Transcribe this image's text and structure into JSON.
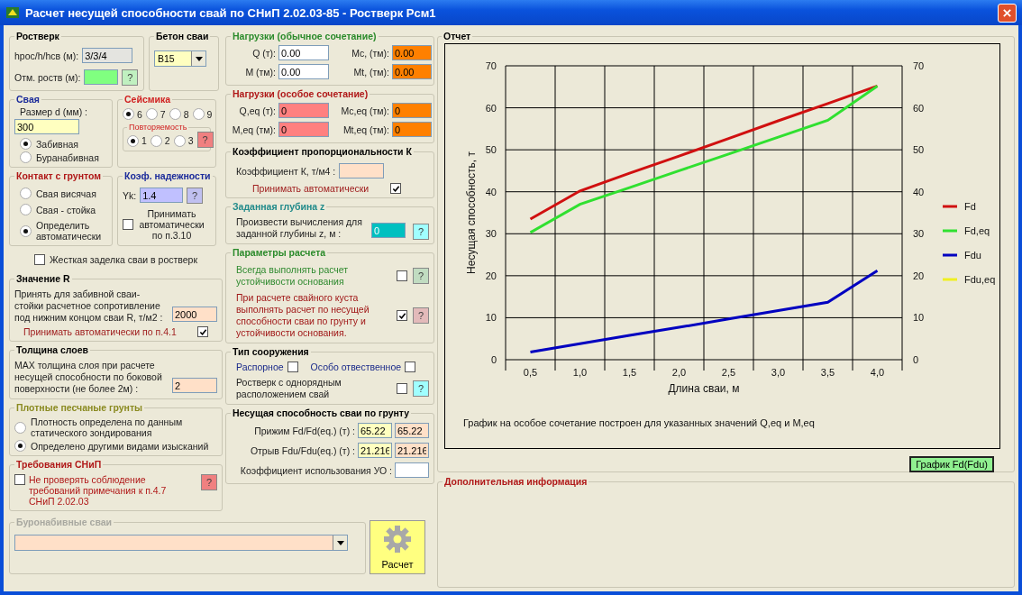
{
  "window": {
    "title": "Расчет несущей способности свай по СНиП 2.02.03-85 - Ростверк Рсм1"
  },
  "rostverk": {
    "title": "Ростверк",
    "height_label": "hрос/h/hсв (м):",
    "height_value": "3/3/4",
    "mark_label": "Отм. роств (м):",
    "mark_help": "?"
  },
  "concrete": {
    "title": "Бетон сваи",
    "value": "B15"
  },
  "pile": {
    "title": "Свая",
    "size_label": "Размер d (мм) :",
    "size_value": "300",
    "types": [
      {
        "label": "Забивная",
        "selected": true
      },
      {
        "label": "Буранабивная",
        "selected": false
      }
    ]
  },
  "seismic": {
    "title": "Сейсмика",
    "options": [
      {
        "label": "6",
        "selected": true
      },
      {
        "label": "7",
        "selected": false
      },
      {
        "label": "8",
        "selected": false
      },
      {
        "label": "9",
        "selected": false
      }
    ],
    "repeat": {
      "title": "Повторяемость",
      "options": [
        {
          "label": "1",
          "selected": true
        },
        {
          "label": "2",
          "selected": false
        },
        {
          "label": "3",
          "selected": false
        }
      ],
      "help": "?"
    }
  },
  "contact": {
    "title": "Контакт с грунтом",
    "options": [
      {
        "label": "Свая висячая",
        "selected": false
      },
      {
        "label": "Свая - стойка",
        "selected": false
      },
      {
        "label": "Определить автоматически",
        "selected": true
      }
    ]
  },
  "reliability": {
    "title": "Коэф. надежности",
    "label": "Yk:",
    "value": "1.4",
    "help": "?",
    "auto": {
      "label": "Принимать автоматически по п.3.10",
      "checked": false
    }
  },
  "rigid": {
    "label": "Жесткая заделка сваи в ростверк",
    "checked": false
  },
  "r_value": {
    "title": "Значение R",
    "text": "Принять для забивной сваи-стойки расчетное сопротивление под нижним концом сваи R, т/м2 :",
    "value": "2000",
    "auto": {
      "label": "Принимать автоматически по п.4.1",
      "checked": true
    }
  },
  "layers": {
    "title": "Толщина слоев",
    "text": "MAX толщина слоя при расчете несущей способности по боковой поверхности (не более 2м) :",
    "value": "2"
  },
  "dense_sands": {
    "title": "Плотные песчаные грунты",
    "options": [
      {
        "label": "Плотность определена по данным статического зондирования",
        "selected": false
      },
      {
        "label": "Определено другими видами изысканий",
        "selected": true
      }
    ]
  },
  "snip": {
    "title": "Требования СНиП",
    "label": "Не проверять соблюдение требований примечания к п.4.7 СНиП 2.02.03",
    "checked": false,
    "help": "?"
  },
  "bored": {
    "title": "Буронабивные сваи",
    "disabled": true
  },
  "loads": {
    "title": "Нагрузки (обычное сочетание)",
    "fields": [
      {
        "label": "Q (т):",
        "value": "0.00",
        "kind": "force"
      },
      {
        "label": "Mc, (тм):",
        "value": "0.00",
        "kind": "moment"
      },
      {
        "label": "M (тм):",
        "value": "0.00",
        "kind": "force"
      },
      {
        "label": "Mt, (тм):",
        "value": "0.00",
        "kind": "moment"
      }
    ]
  },
  "special_loads": {
    "title": "Нагрузки (особое сочетание)",
    "fields": [
      {
        "label": "Q,eq (т):",
        "value": "0",
        "kind": "special"
      },
      {
        "label": "Mc,eq (тм):",
        "value": "0",
        "kind": "moment"
      },
      {
        "label": "M,eq (тм):",
        "value": "0",
        "kind": "special"
      },
      {
        "label": "Mt,eq (тм):",
        "value": "0",
        "kind": "moment"
      }
    ]
  },
  "k_coef": {
    "title": "Коэффициент пропорциональности К",
    "label": "Коэффициент К, т/м4 :",
    "auto": {
      "label": "Принимать автоматически",
      "checked": true
    }
  },
  "depth": {
    "title": "Заданная глубина z",
    "label": "Произвести вычисления для заданной глубины z, м :",
    "value": "0",
    "help": "?"
  },
  "params": {
    "title": "Параметры расчета",
    "options": [
      {
        "label": "Всегда выполнять расчет устойчивости основания",
        "checked": false,
        "help": "?",
        "color": "#2f8a2f"
      },
      {
        "label": "При расчете свайного куста выполнять расчет по несущей способности сваи по грунту и устойчивости основания.",
        "checked": true,
        "help": "?",
        "color": "#a01818"
      }
    ]
  },
  "structure": {
    "title": "Тип сооружения",
    "options": [
      {
        "label": "Распорное",
        "checked": false
      },
      {
        "label": "Особо отвественное",
        "checked": false
      },
      {
        "label": "Ростверк с однорядным расположением свай",
        "checked": false,
        "help": "?"
      }
    ]
  },
  "capacity": {
    "title": "Несущая способность сваи по грунту",
    "rows": [
      {
        "label": "Прижим Fd/Fd(eq.) (т) :",
        "value": "65.22",
        "value_eq": "65.22"
      },
      {
        "label": "Отрыв Fdu/Fdu(eq.) (т) :",
        "value": "21.216",
        "value_eq": "21.216"
      }
    ],
    "usage_label": "Коэффициент использования  УО :"
  },
  "calc_button": {
    "label": "Расчет"
  },
  "report": {
    "title": "Отчет",
    "note": "График на особое сочетание построен для указанных значений Q,eq и M,eq",
    "graph_button": "График Fd(Fdu)",
    "chart_data": {
      "type": "line",
      "xlabel": "Длина сваи, м",
      "ylabel": "Несущая способность, т",
      "categories": [
        "0,5",
        "1,0",
        "1,5",
        "2,0",
        "2,5",
        "3,0",
        "3,5",
        "4,0"
      ],
      "ylim": [
        0,
        70
      ],
      "yticks": [
        0,
        10,
        20,
        30,
        40,
        50,
        60,
        70
      ],
      "y2ticks": [
        0,
        10,
        20,
        30,
        40,
        50,
        60,
        70
      ],
      "y2lim": [
        0,
        70
      ],
      "grid": true,
      "legend": true,
      "series": [
        {
          "name": "Fd",
          "color": "#d01010",
          "values": [
            33.5,
            40.2,
            44.4,
            48.5,
            52.7,
            56.9,
            61.0,
            65.2
          ]
        },
        {
          "name": "Fd,eq",
          "color": "#30e030",
          "values": [
            30.3,
            37.0,
            41.0,
            45.0,
            49.0,
            53.0,
            57.0,
            65.2
          ]
        },
        {
          "name": "Fdu",
          "color": "#0000c0",
          "values": [
            1.8,
            3.8,
            5.8,
            7.7,
            9.7,
            11.7,
            13.7,
            21.2
          ]
        },
        {
          "name": "Fdu,eq",
          "color": "#f0f020",
          "values": [
            null,
            null,
            null,
            null,
            null,
            null,
            null,
            null
          ]
        }
      ]
    }
  },
  "extra": {
    "title": "Дополнительная информация"
  }
}
